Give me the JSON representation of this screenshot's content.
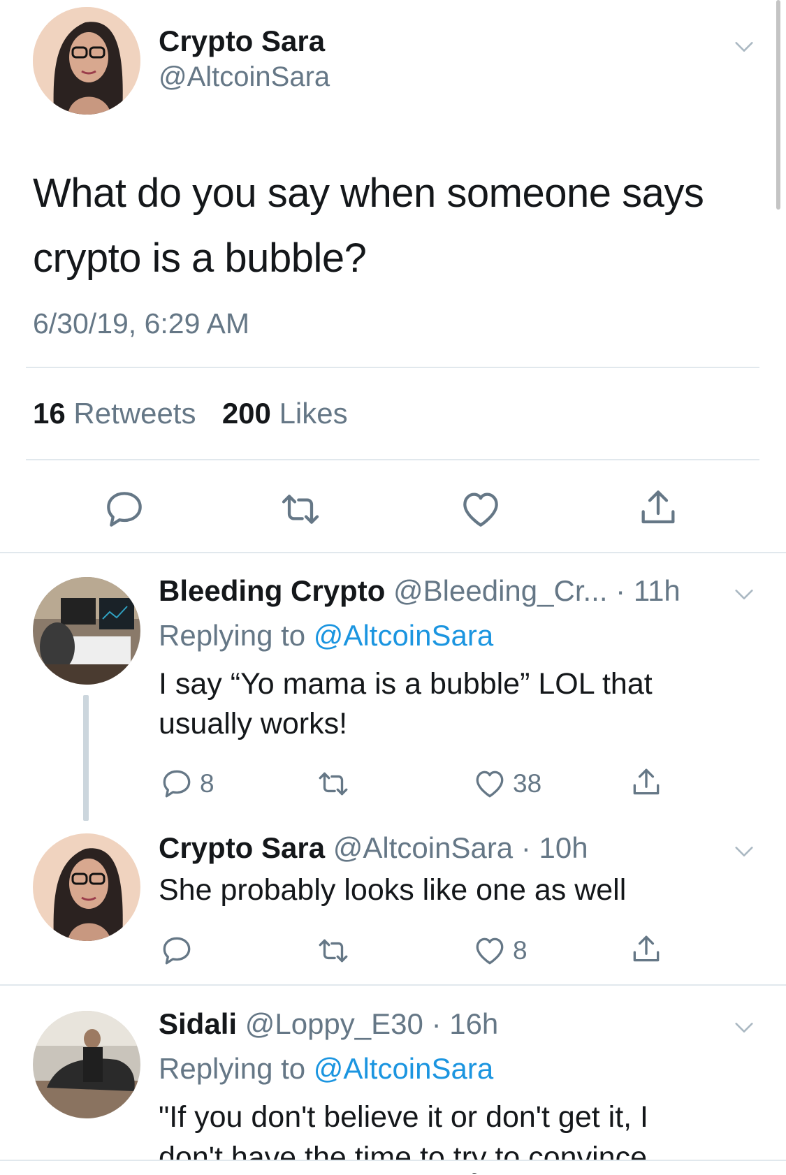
{
  "main_tweet": {
    "display_name": "Crypto Sara",
    "handle": "@AltcoinSara",
    "text_line1": "What do you say when someone says",
    "text_line2": "crypto is a bubble?",
    "timestamp": "6/30/19, 6:29 AM",
    "retweet_count": "16",
    "retweet_label": "Retweets",
    "like_count": "200",
    "like_label": "Likes"
  },
  "replies": [
    {
      "display_name": "Bleeding Crypto",
      "handle": "@Bleeding_Cr...",
      "time": "· 11h",
      "replying_prefix": "Replying to",
      "replying_handle": "@AltcoinSara",
      "text_line1": "I say “Yo mama is a bubble” LOL that",
      "text_line2": "usually works!",
      "reply_count": "8",
      "like_count": "38"
    },
    {
      "display_name": "Crypto Sara",
      "handle": "@AltcoinSara",
      "time": "· 10h",
      "text_line1": "She probably looks like one as well",
      "like_count": "8"
    },
    {
      "display_name": "Sidali",
      "handle": "@Loppy_E30",
      "time": "· 16h",
      "replying_prefix": "Replying to",
      "replying_handle": "@AltcoinSara",
      "text_line1": "\"If you don't believe it or don't get it, I",
      "text_line2": "don't have the time to try to convince"
    }
  ],
  "icons": {
    "reply": "reply-icon",
    "retweet": "retweet-icon",
    "like": "heart-icon",
    "share": "share-icon",
    "more": "chevron-down-icon"
  },
  "colors": {
    "text": "#14171a",
    "muted": "#657786",
    "link": "#1b95e0",
    "divider": "#e1e8ed"
  }
}
